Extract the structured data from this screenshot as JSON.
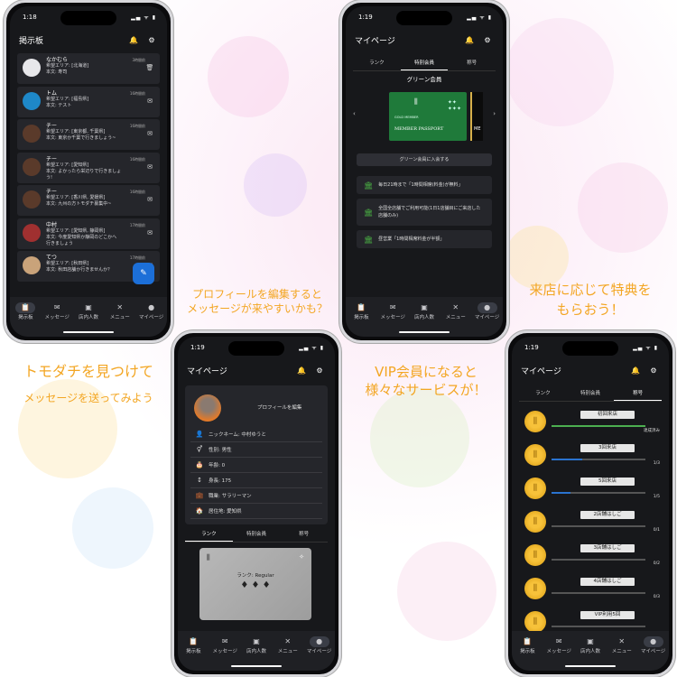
{
  "captions": {
    "c1": "トモダチを見つけて",
    "c1b": "メッセージを送ってみよう",
    "c2": "プロフィールを編集すると",
    "c2b": "メッセージが来やすいかも？",
    "c3": "VIP会員になると",
    "c3b": "様々なサービスが！",
    "c4": "来店に応じて特典を",
    "c4b": "もらおう！"
  },
  "nav": {
    "board": "掲示板",
    "message": "メッセージ",
    "store": "店内人数",
    "menu": "メニュー",
    "mypage": "マイページ"
  },
  "phone1": {
    "time": "1:18",
    "title": "掲示板",
    "messages": [
      {
        "name": "なかむら",
        "time": "3時間前",
        "l1": "希望エリア: [北海道]",
        "l2": "本文: 寿司",
        "l3": "",
        "icon": "🗑"
      },
      {
        "name": "トム",
        "time": "16時間前",
        "l1": "希望エリア: [福島県]",
        "l2": "本文: テスト",
        "l3": "",
        "icon": "✉"
      },
      {
        "name": "チー",
        "time": "16時間前",
        "l1": "希望エリア: [東京都, 千葉県]",
        "l2": "本文: 東京か千葉で行きましょう~",
        "l3": "",
        "icon": "✉"
      },
      {
        "name": "チー",
        "time": "16時間前",
        "l1": "希望エリア: [愛知県]",
        "l2": "本文: よかったら栄辺りで行きましょ",
        "l3": "う!",
        "icon": "✉"
      },
      {
        "name": "チー",
        "time": "16時間前",
        "l1": "希望エリア: [香川県, 愛媛県]",
        "l2": "本文: 九州の方トモダチ募集中~",
        "l3": "",
        "icon": "✉"
      },
      {
        "name": "中村",
        "time": "17時間前",
        "l1": "希望エリア: [愛知県, 静岡県]",
        "l2": "本文: 今度愛知県か静岡のどこかへ",
        "l3": "行きましょう",
        "icon": "✉"
      },
      {
        "name": "てつ",
        "time": "17時間前",
        "l1": "希望エリア: [秋田県]",
        "l2": "本文: 秋田店舗か行きませんか？",
        "l3": "",
        "icon": "✉"
      }
    ]
  },
  "phone2": {
    "time": "1:19",
    "title": "マイページ",
    "edit": "プロフィールを編集",
    "rows": [
      {
        "icon": "👤",
        "text": "ニックネーム: 中村ゆうと"
      },
      {
        "icon": "⚥",
        "text": "性別: 男性"
      },
      {
        "icon": "🎂",
        "text": "年齢: 0"
      },
      {
        "icon": "↕",
        "text": "身長: 175"
      },
      {
        "icon": "💼",
        "text": "職業: サラリーマン"
      },
      {
        "icon": "🏠",
        "text": "居住地: 愛知県"
      }
    ],
    "tabs": [
      "ランク",
      "特別会員",
      "称号"
    ],
    "rank": "ランク: Regular"
  },
  "phone3": {
    "time": "1:19",
    "title": "マイページ",
    "tabs": [
      "ランク",
      "特別会員",
      "称号"
    ],
    "plan": "グリーン会員",
    "passport": "MEMBER PASSPORT",
    "passport_small": "GOLD MEMBER",
    "next_card": "ME",
    "join": "グリーン会員に入会する",
    "perks": [
      {
        "text": "毎日21時まで「1時間相席(料金)が無料」",
        "lines": 1
      },
      {
        "text": "全国全店舗でご利用可能(1日1店舗目にご来店した店舗のみ)",
        "lines": 2
      },
      {
        "text": "昼営業「1時間相席料金が半額」",
        "lines": 1
      }
    ]
  },
  "phone4": {
    "time": "1:19",
    "title": "マイページ",
    "tabs": [
      "ランク",
      "特別会員",
      "称号"
    ],
    "badges": [
      {
        "label": "初回来店",
        "fraction": 1.0,
        "num": "達成済み"
      },
      {
        "label": "3回来店",
        "fraction": 0.33,
        "num": "1/3"
      },
      {
        "label": "5回来店",
        "fraction": 0.2,
        "num": "1/5"
      },
      {
        "label": "2店舗はしご",
        "fraction": 0,
        "num": "0/1"
      },
      {
        "label": "3店舗はしご",
        "fraction": 0,
        "num": "0/2"
      },
      {
        "label": "4店舗はしご",
        "fraction": 0,
        "num": "0/3"
      },
      {
        "label": "VIP利用5回",
        "fraction": 0,
        "num": ""
      }
    ]
  },
  "colors": {
    "caption": "#f3a623",
    "accent": "#1c6fd8",
    "green": "#4caf50",
    "card_green": "#1f7a3a"
  }
}
